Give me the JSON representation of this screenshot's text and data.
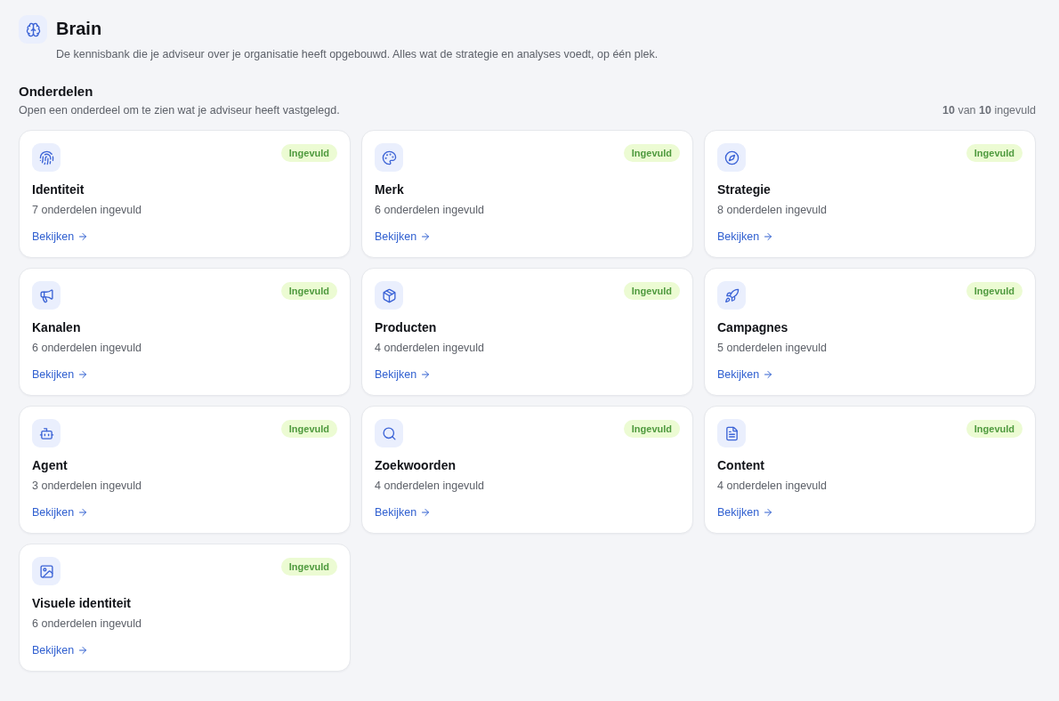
{
  "header": {
    "title": "Brain",
    "description": "De kennisbank die je adviseur over je organisatie heeft opgebouwd. Alles wat de strategie en analyses voedt, op één plek."
  },
  "section": {
    "title": "Onderdelen",
    "subtitle": "Open een onderdeel om te zien wat je adviseur heeft vastgelegd.",
    "completion": "**10** van **10** ingevuld"
  },
  "cards": [
    {
      "title": "Identiteit",
      "detail": "7 onderdelen ingevuld",
      "badge": "Ingevuld",
      "link": "Bekijken"
    },
    {
      "title": "Merk",
      "detail": "6 onderdelen ingevuld",
      "badge": "Ingevuld",
      "link": "Bekijken"
    },
    {
      "title": "Strategie",
      "detail": "8 onderdelen ingevuld",
      "badge": "Ingevuld",
      "link": "Bekijken"
    },
    {
      "title": "Kanalen",
      "detail": "6 onderdelen ingevuld",
      "badge": "Ingevuld",
      "link": "Bekijken"
    },
    {
      "title": "Producten",
      "detail": "4 onderdelen ingevuld",
      "badge": "Ingevuld",
      "link": "Bekijken"
    },
    {
      "title": "Campagnes",
      "detail": "5 onderdelen ingevuld",
      "badge": "Ingevuld",
      "link": "Bekijken"
    },
    {
      "title": "Agent",
      "detail": "3 onderdelen ingevuld",
      "badge": "Ingevuld",
      "link": "Bekijken"
    },
    {
      "title": "Zoekwoorden",
      "detail": "4 onderdelen ingevuld",
      "badge": "Ingevuld",
      "link": "Bekijken"
    },
    {
      "title": "Content",
      "detail": "4 onderdelen ingevuld",
      "badge": "Ingevuld",
      "link": "Bekijken"
    },
    {
      "title": "Visuele identiteit",
      "detail": "6 onderdelen ingevuld",
      "badge": "Ingevuld",
      "link": "Bekijken"
    }
  ]
}
